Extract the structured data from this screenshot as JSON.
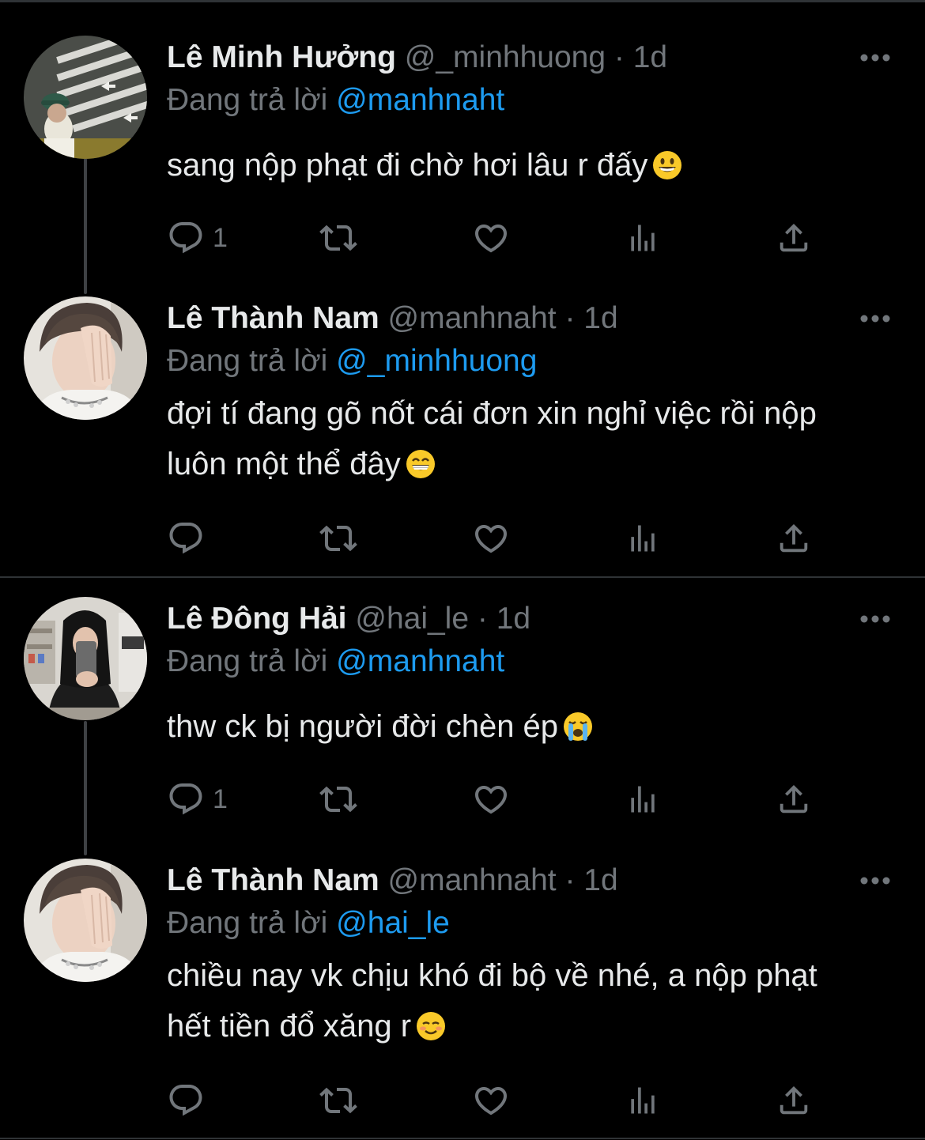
{
  "colors": {
    "background": "#000000",
    "text": "#e7e9ea",
    "muted": "#71767b",
    "link": "#1d9bf0",
    "divider": "#2f3336"
  },
  "tweets": [
    {
      "name": "Lê Minh Hưởng",
      "handle": "@_minhhuong",
      "sep": "·",
      "time": "1d",
      "reply_prefix": "Đang trả lời",
      "reply_to": "@manhnaht",
      "text_lines": [
        "sang nộp phạt đi chờ hơi lâu r đấy"
      ],
      "emoji": "grinning-face-emoji",
      "reply_count": "1",
      "avatar": "avatar-crosswalk"
    },
    {
      "name": "Lê Thành Nam",
      "handle": "@manhnaht",
      "sep": "·",
      "time": "1d",
      "reply_prefix": "Đang trả lời",
      "reply_to": "@_minhhuong",
      "text_lines": [
        "đợi tí đang gõ nốt cái đơn xin nghỉ việc rồi nộp",
        "luôn một thể đây"
      ],
      "emoji": "beaming-face-emoji",
      "reply_count": "",
      "avatar": "avatar-hand-face"
    },
    {
      "name": "Lê Đông Hải",
      "handle": "@hai_le",
      "sep": "·",
      "time": "1d",
      "reply_prefix": "Đang trả lời",
      "reply_to": "@manhnaht",
      "text_lines": [
        "thw ck bị người đời chèn ép"
      ],
      "emoji": "crying-face-emoji",
      "reply_count": "1",
      "avatar": "avatar-mirror-selfie"
    },
    {
      "name": "Lê Thành Nam",
      "handle": "@manhnaht",
      "sep": "·",
      "time": "1d",
      "reply_prefix": "Đang trả lời",
      "reply_to": "@hai_le",
      "text_lines": [
        "chiều nay vk chịu khó đi bộ về nhé, a nộp phạt",
        "hết tiền đổ xăng r"
      ],
      "emoji": "smiling-blush-emoji",
      "reply_count": "",
      "avatar": "avatar-hand-face"
    }
  ],
  "icons": {
    "reply": "reply-icon",
    "retweet": "retweet-icon",
    "like": "heart-icon",
    "views": "views-icon",
    "share": "share-icon",
    "more": "more-icon"
  }
}
